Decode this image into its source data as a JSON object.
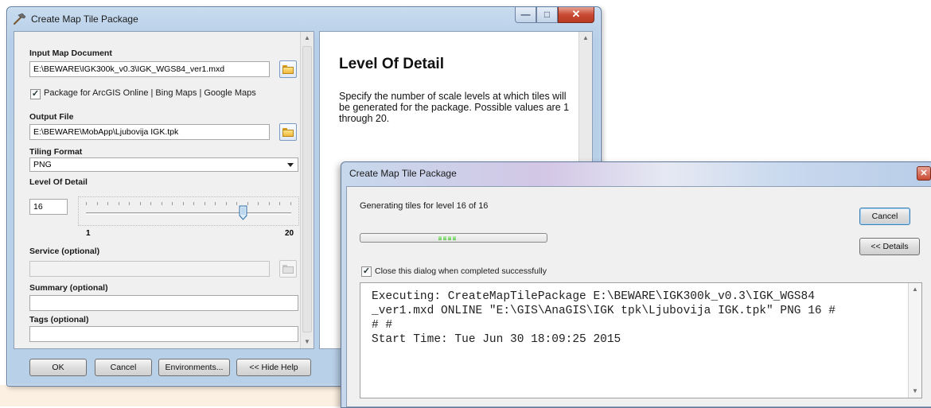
{
  "main_window": {
    "title": "Create Map Tile Package",
    "caption_buttons": {
      "minimize": "—",
      "maximize": "□",
      "close": "✕"
    },
    "form": {
      "input_map_document": {
        "label": "Input Map Document",
        "value": "E:\\BEWARE\\IGK300k_v0.3\\IGK_WGS84_ver1.mxd"
      },
      "package_checkbox": {
        "checked": true,
        "label": "Package for ArcGIS Online | Bing Maps | Google Maps"
      },
      "output_file": {
        "label": "Output File",
        "value": "E:\\BEWARE\\MobApp\\Ljubovija IGK.tpk"
      },
      "tiling_format": {
        "label": "Tiling Format",
        "value": "PNG"
      },
      "level_of_detail": {
        "label": "Level Of Detail",
        "value": "16",
        "min": "1",
        "max": "20",
        "slider_value": 16
      },
      "service": {
        "label": "Service (optional)",
        "value": ""
      },
      "summary": {
        "label": "Summary (optional)",
        "value": ""
      },
      "tags": {
        "label": "Tags (optional)",
        "value": ""
      }
    },
    "help": {
      "title": "Level Of Detail",
      "text": "Specify the number of scale levels at which tiles will be generated for the package. Possible values are 1 through 20."
    },
    "buttons": {
      "ok": "OK",
      "cancel": "Cancel",
      "environments": "Environments...",
      "hide_help": "<< Hide Help"
    }
  },
  "progress_dialog": {
    "title": "Create Map Tile Package",
    "close_glyph": "✕",
    "status": "Generating tiles for level 16 of 16",
    "cancel": "Cancel",
    "details": "<< Details",
    "close_when_done": {
      "checked": true,
      "label": "Close this dialog when completed successfully"
    },
    "log": "Executing: CreateMapTilePackage E:\\BEWARE\\IGK300k_v0.3\\IGK_WGS84\n_ver1.mxd ONLINE \"E:\\GIS\\AnaGIS\\IGK tpk\\Ljubovija IGK.tpk\" PNG 16 #\n# #\nStart Time: Tue Jun 30 18:09:25 2015"
  },
  "icons": {
    "app": "hammer-icon",
    "browse": "folder-open-icon",
    "check": "✓"
  }
}
